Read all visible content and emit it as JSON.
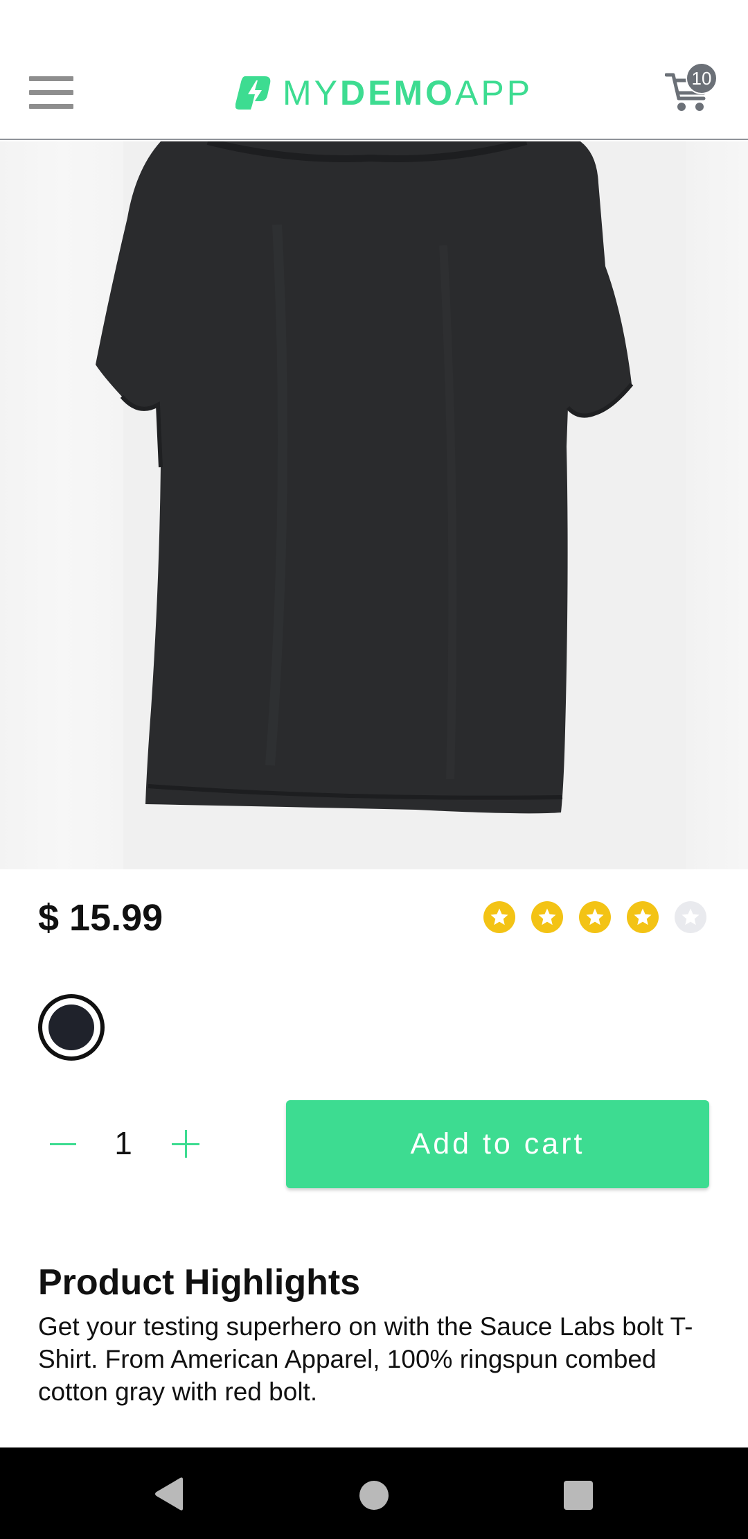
{
  "header": {
    "logo_light": "MY",
    "logo_bold": "DEMO",
    "logo_light2": "APP",
    "cart_count": "10",
    "icons": {
      "menu": "hamburger-icon",
      "cart": "cart-icon",
      "logo": "bolt-logo-icon"
    }
  },
  "product": {
    "price": "$ 15.99",
    "rating": 4,
    "rating_max": 5,
    "color_option": "#1f222b",
    "quantity": "1",
    "add_to_cart_label": "Add to cart"
  },
  "highlights": {
    "title": "Product Highlights",
    "text": "Get your testing superhero on with the Sauce Labs bolt T-Shirt. From American Apparel, 100% ringspun combed cotton gray with red bolt."
  },
  "colors": {
    "accent": "#3ddc91",
    "star": "#f3c315",
    "star_off": "#e9eaee",
    "badge": "#6b7077"
  },
  "navbar": {
    "icons": [
      "back-icon",
      "home-icon",
      "recents-icon"
    ]
  }
}
